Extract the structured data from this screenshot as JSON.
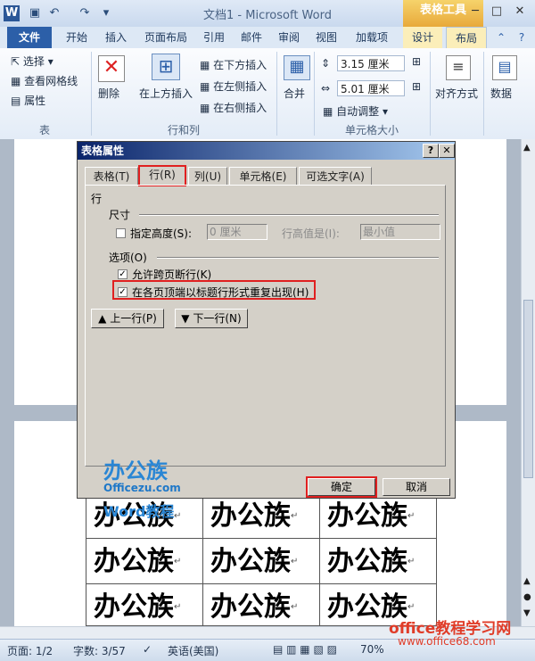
{
  "titlebar": {
    "title": "文档1 - Microsoft Word",
    "context_tab_group": "表格工具",
    "minimize": "─",
    "maximize": "□",
    "close": "✕"
  },
  "tabs": [
    "文件",
    "开始",
    "插入",
    "页面布局",
    "引用",
    "邮件",
    "审阅",
    "视图",
    "加载项",
    "设计",
    "布局"
  ],
  "ribbon": {
    "table_group": {
      "select": "选择",
      "gridlines": "查看网格线",
      "properties": "属性",
      "label": "表"
    },
    "rows_cols_group": {
      "delete": "删除",
      "insert_above": "在上方插入",
      "insert_below": "在下方插入",
      "insert_left": "在左侧插入",
      "insert_right": "在右侧插入",
      "label": "行和列"
    },
    "merge_label": "合并",
    "cell_size_group": {
      "height": "3.15 厘米",
      "width": "5.01 厘米",
      "autofit": "自动调整",
      "label": "单元格大小"
    },
    "align_label": "对齐方式",
    "data_label": "数据"
  },
  "dialog": {
    "title": "表格属性",
    "help": "?",
    "close": "✕",
    "tabs": [
      "表格(T)",
      "行(R)",
      "列(U)",
      "单元格(E)",
      "可选文字(A)"
    ],
    "section_row": "行",
    "size_label": "尺寸",
    "specify_height": "指定高度(S):",
    "height_value": "0 厘米",
    "row_height_is": "行高值是(I):",
    "row_height_rule": "最小值",
    "options_label": "选项(O)",
    "allow_break": "允许跨页断行(K)",
    "repeat_header": "在各页顶端以标题行形式重复出现(H)",
    "prev_row": "上一行(P)",
    "next_row": "下一行(N)",
    "ok": "确定",
    "cancel": "取消"
  },
  "watermark": {
    "brand": "办公族",
    "site": "Officezu.com",
    "course": "Word教程"
  },
  "table_cells": [
    [
      "办公族",
      "办公族",
      "办公族"
    ],
    [
      "办公族",
      "办公族",
      "办公族"
    ],
    [
      "办公族",
      "办公族",
      "办公族"
    ]
  ],
  "status": {
    "page": "页面: 1/2",
    "words": "字数: 3/57",
    "language": "英语(美国)",
    "zoom": "70%"
  },
  "site_watermark": {
    "title": "office教程学习网",
    "url": "www.office68.com"
  },
  "colors": {
    "file_tab": "#2c5fa8",
    "context": "#e8a93a",
    "highlight": "#e02020",
    "dialog_title": "#0a246a"
  }
}
